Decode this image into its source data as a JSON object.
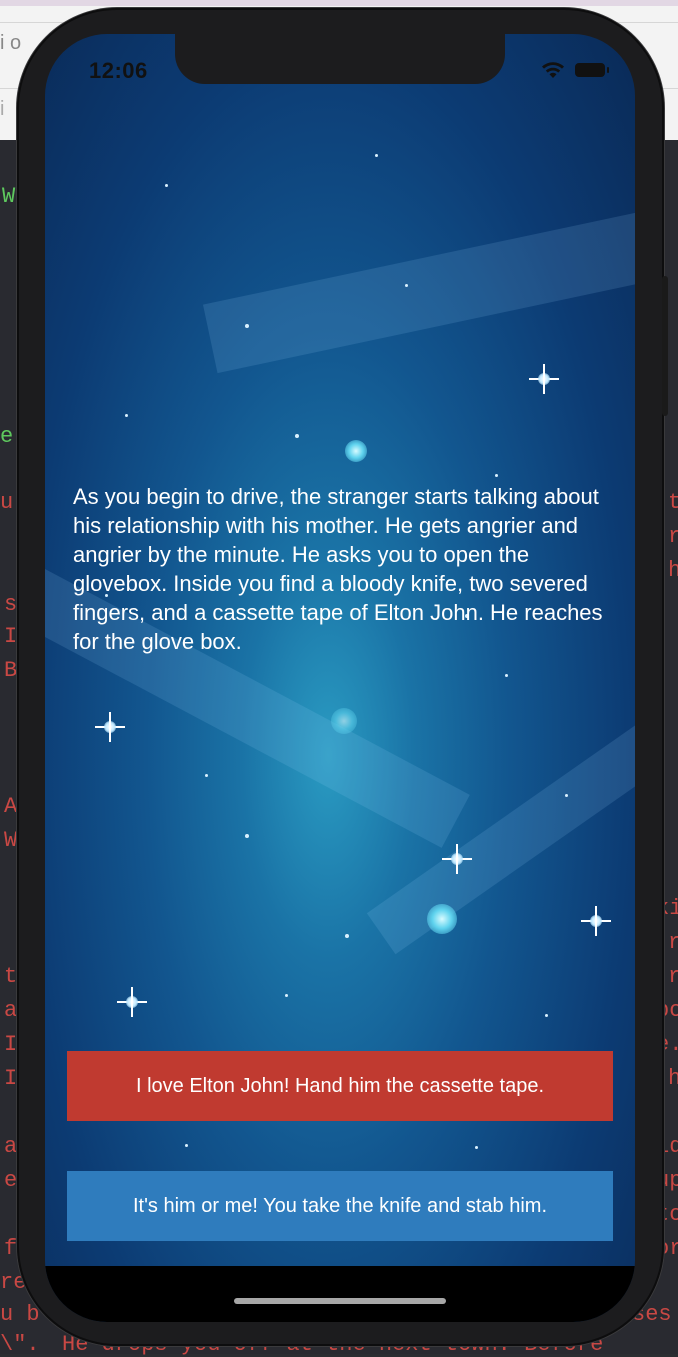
{
  "background_editor": {
    "left_fragments": [
      "i o",
      "i",
      "W",
      "e",
      "u",
      "s",
      "I",
      "B",
      "A",
      "W",
      "t",
      "a",
      "I",
      "I",
      "a",
      "e",
      "f",
      "re",
      "u b",
      "\\\"."
    ],
    "right_fragments": [
      "t",
      "r",
      "h",
      "ki",
      "r",
      "r",
      "bo",
      "e.",
      "h",
      "id",
      "up",
      "to",
      "or",
      "ses"
    ],
    "bottom_line": "He drops you off at the next town. Before"
  },
  "status_bar": {
    "time": "12:06"
  },
  "story": {
    "text": "As you begin to drive, the stranger starts talking about his relationship with his mother. He gets angrier and angrier by the minute. He asks you to open the glovebox. Inside you find a bloody knife, two severed fingers, and a cassette tape of Elton John. He reaches for the glove box."
  },
  "choices": [
    {
      "label": "I love Elton John! Hand him the cassette tape.",
      "color": "#c03a30"
    },
    {
      "label": "It's him or me! You take the knife and stab him.",
      "color": "#2f7cbd"
    }
  ],
  "icons": [
    "wifi-icon",
    "battery-icon"
  ]
}
